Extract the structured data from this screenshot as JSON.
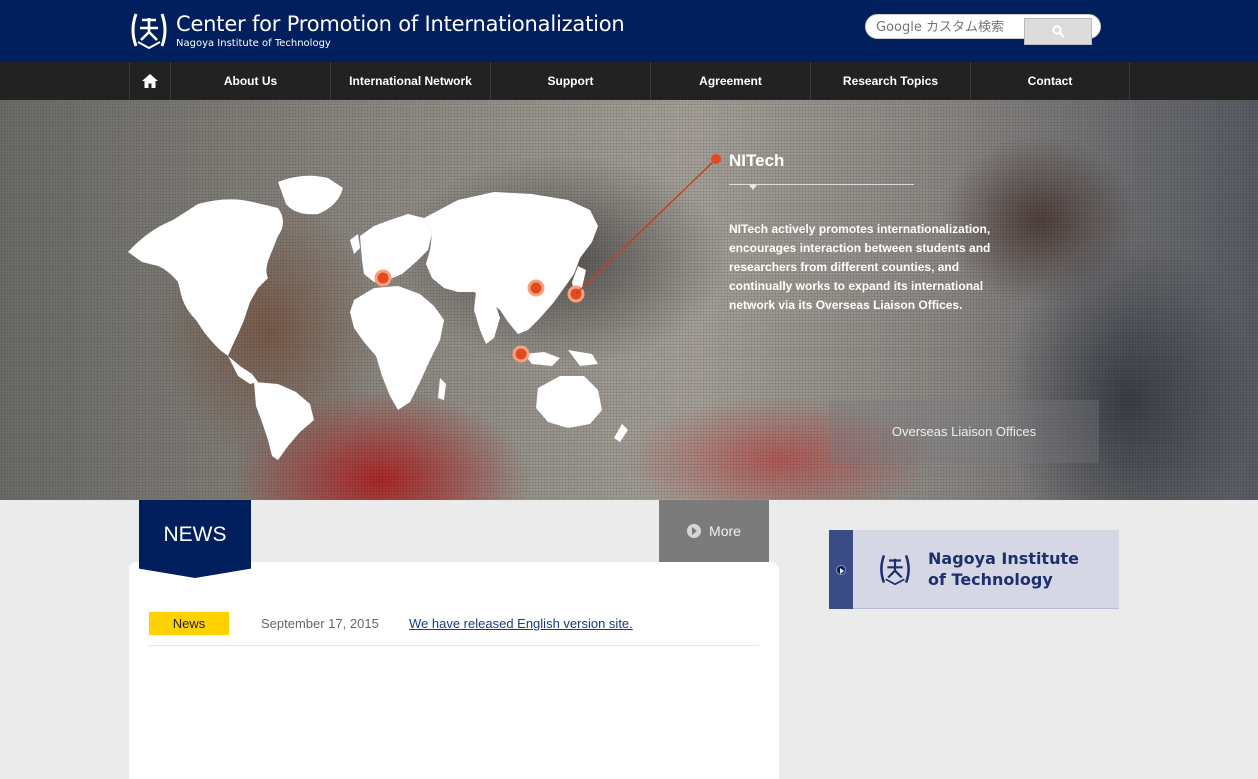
{
  "header": {
    "title": "Center for Promotion of Internationalization",
    "subtitle": "Nagoya Institute of Technology",
    "search_placeholder": "Google カスタム検索"
  },
  "nav": {
    "items": [
      {
        "label": "About Us"
      },
      {
        "label": "International Network"
      },
      {
        "label": "Support"
      },
      {
        "label": "Agreement"
      },
      {
        "label": "Research Topics"
      },
      {
        "label": "Contact"
      }
    ]
  },
  "hero": {
    "title": "NITech",
    "description": "NITech actively promotes internationalization, encourages interaction between students and researchers from different counties, and continually works to expand its international network via its Overseas Liaison Offices.",
    "overseas_label": "Overseas Liaison Offices"
  },
  "news": {
    "heading": "NEWS",
    "more_label": "More",
    "items": [
      {
        "category": "News",
        "date": "September 17, 2015",
        "title": "We have released English version site."
      }
    ]
  },
  "banner": {
    "label": "Nagoya Institute of Technology"
  },
  "colors": {
    "header_bg": "#001f5c",
    "nav_bg": "#222222",
    "accent_red": "#d9371c",
    "badge_yellow": "#ffd100"
  }
}
